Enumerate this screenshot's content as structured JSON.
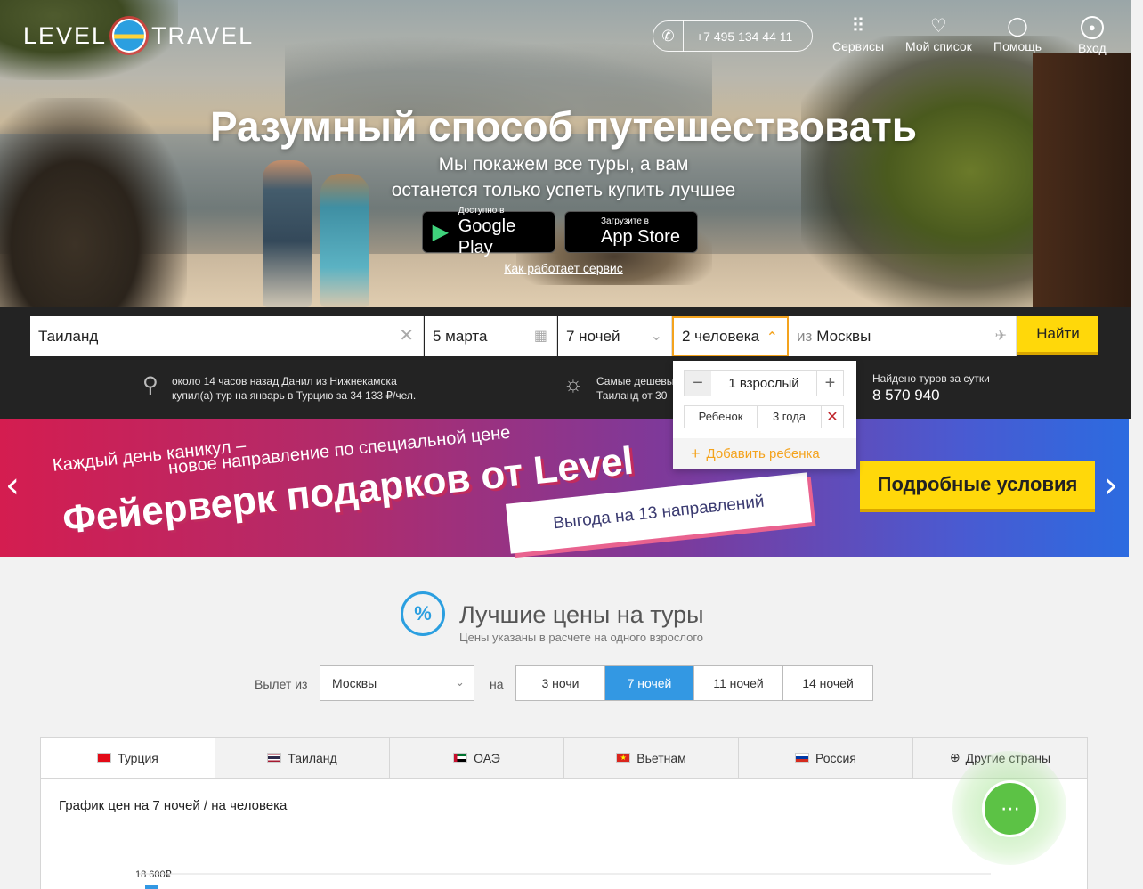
{
  "header": {
    "logo_left": "LEVEL",
    "logo_right": "TRAVEL",
    "phone": "+7 495 134 44 11",
    "nav": [
      {
        "label": "Сервисы",
        "icon": "grid-icon"
      },
      {
        "label": "Мой список",
        "icon": "heart-icon"
      },
      {
        "label": "Помощь",
        "icon": "bulb-icon"
      },
      {
        "label": "Вход",
        "icon": "user-icon"
      }
    ]
  },
  "hero": {
    "headline": "Разумный способ путешествовать",
    "sub1": "Мы покажем все туры, а вам",
    "sub2": "останется только успеть купить лучшее",
    "google_small": "Доступно в",
    "google_big": "Google Play",
    "apple_small": "Загрузите в",
    "apple_big": "App Store",
    "how_link": "Как работает сервис"
  },
  "search": {
    "destination": "Таиланд",
    "date": "5 марта",
    "nights": "7 ночей",
    "people": "2 человека",
    "from_prefix": "из",
    "from_city": "Москвы",
    "find_button": "Найти"
  },
  "guests_dropdown": {
    "adults": "1 взрослый",
    "child_label": "Ребенок",
    "child_age": "3 года",
    "add_child": "Добавить ребенка"
  },
  "info_strip": {
    "recent_line1": "около 14 часов назад Данил из Нижнекамска",
    "recent_line2": "купил(а) тур на январь в Турцию за 34 133 ₽/чел.",
    "cheap_line1": "Самые дешевы",
    "cheap_line2": "Таиланд от 30",
    "found_label": "Найдено туров за сутки",
    "found_value": "8 570 940"
  },
  "banner": {
    "line1": "Каждый день каникул –",
    "line2": "новое направление по специальной цене",
    "big": "Фейерверк подарков от Level",
    "ticket": "Выгода на 13 направлений",
    "cta": "Подробные условия"
  },
  "best_prices": {
    "icon_text": "%",
    "title": "Лучшие цены на туры",
    "subtitle": "Цены указаны в расчете на одного взрослого",
    "from_label": "Вылет из",
    "city": "Москвы",
    "on_label": "на",
    "nights": [
      "3 ночи",
      "7 ночей",
      "11 ночей",
      "14 ночей"
    ],
    "selected_nights": "7 ночей",
    "countries": [
      "Турция",
      "Таиланд",
      "ОАЭ",
      "Вьетнам",
      "Россия",
      "Другие страны"
    ],
    "selected_country": "Турция",
    "chart_title": "График цен на 7 ночей / на человека",
    "chart_tick": "18 600₽"
  },
  "colors": {
    "accent_yellow": "#ffd80a",
    "accent_orange": "#f4a31d",
    "accent_blue": "#3398e3",
    "chat_green": "#5cc245"
  }
}
